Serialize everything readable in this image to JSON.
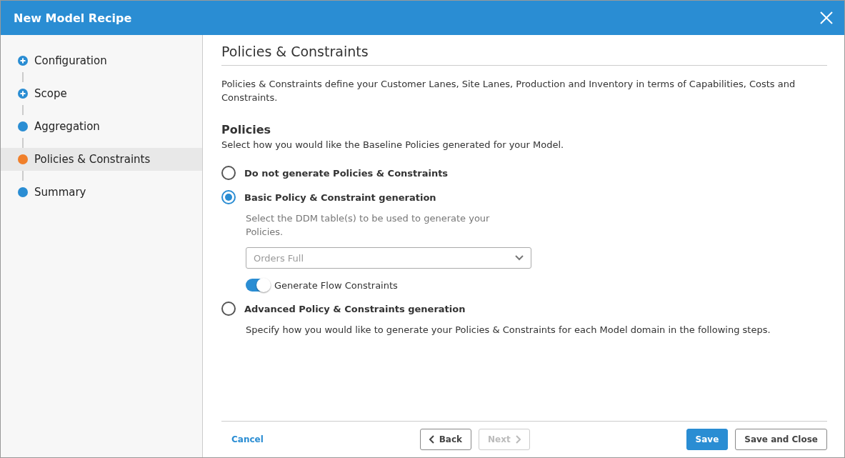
{
  "window": {
    "title": "New Model Recipe"
  },
  "steps": [
    {
      "label": "Configuration",
      "kind": "plus",
      "selected": false
    },
    {
      "label": "Scope",
      "kind": "plus",
      "selected": false
    },
    {
      "label": "Aggregation",
      "kind": "dot",
      "selected": false
    },
    {
      "label": "Policies & Constraints",
      "kind": "dot",
      "selected": true
    },
    {
      "label": "Summary",
      "kind": "dot",
      "selected": false
    }
  ],
  "page": {
    "title": "Policies & Constraints",
    "intro": "Policies & Constraints define your Customer Lanes, Site Lanes, Production and Inventory in terms of Capabilities, Costs and Constraints.",
    "section_title": "Policies",
    "section_text": "Select how you would like the Baseline Policies generated for your Model."
  },
  "options": [
    {
      "label": "Do not generate Policies & Constraints",
      "selected": false
    },
    {
      "label": "Basic Policy & Constraint generation",
      "selected": true,
      "description": "Select the DDM table(s) to be used to generate your Policies.",
      "dropdown": {
        "placeholder": "Orders Full"
      },
      "toggle": {
        "label": "Generate Flow Constraints",
        "on": true
      }
    },
    {
      "label": "Advanced Policy & Constraints generation",
      "selected": false,
      "description": "Specify how you would like to generate your Policies & Constraints for each Model domain in the following steps."
    }
  ],
  "footer": {
    "cancel": "Cancel",
    "back": {
      "label": "Back",
      "disabled": false
    },
    "next": {
      "label": "Next",
      "disabled": true
    },
    "save": "Save",
    "save_close": "Save and Close"
  }
}
